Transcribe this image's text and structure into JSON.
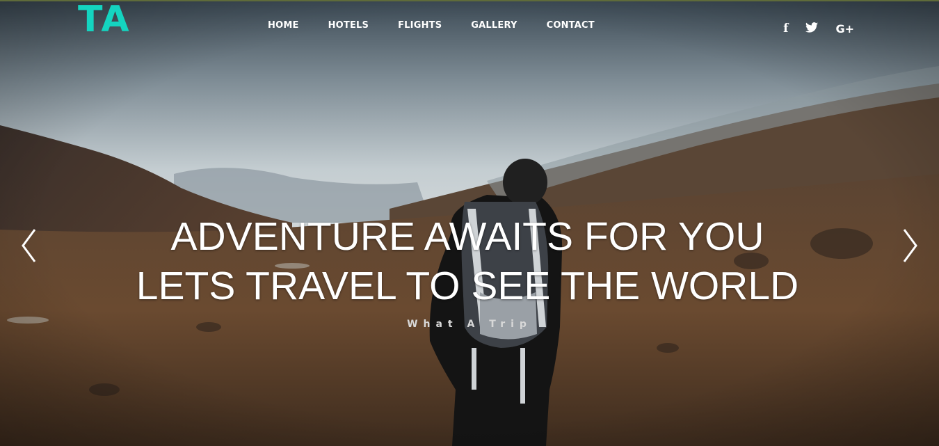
{
  "brand": {
    "logo_text": "TA",
    "accent_color": "#14d4c0"
  },
  "nav": {
    "items": [
      {
        "label": "HOME"
      },
      {
        "label": "HOTELS"
      },
      {
        "label": "FLIGHTS"
      },
      {
        "label": "GALLERY"
      },
      {
        "label": "CONTACT"
      }
    ]
  },
  "social": {
    "icons": [
      {
        "name": "facebook-icon",
        "glyph": "f"
      },
      {
        "name": "twitter-icon",
        "glyph": "🐦"
      },
      {
        "name": "google-plus-icon",
        "glyph": "G+"
      }
    ]
  },
  "hero": {
    "headline_line1": "ADVENTURE AWAITS FOR YOU",
    "headline_line2": "LETS TRAVEL TO SEE THE WORLD",
    "tagline": "What A Trip",
    "prev_icon": "chevron-left-icon",
    "next_icon": "chevron-right-icon"
  }
}
